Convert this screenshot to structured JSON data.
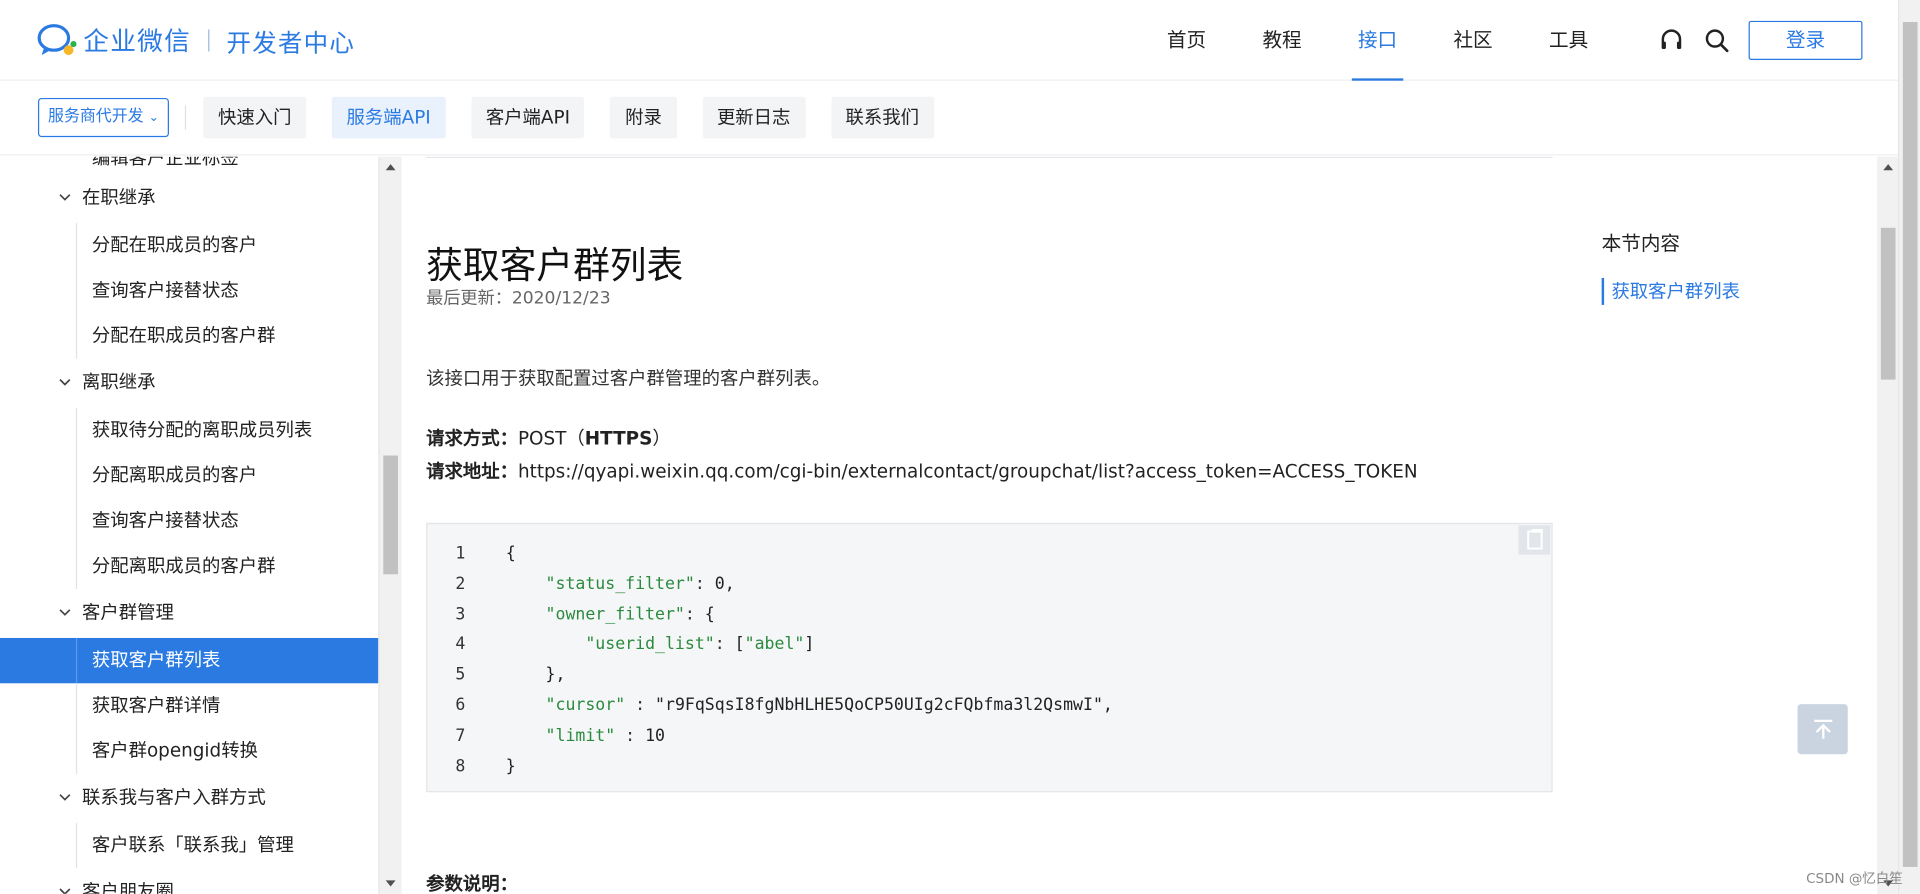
{
  "header": {
    "brand": "企业微信",
    "sub_brand": "开发者中心",
    "nav": [
      "首页",
      "教程",
      "接口",
      "社区",
      "工具"
    ],
    "nav_active": "接口",
    "login_label": "登录"
  },
  "subnav": {
    "mode_label": "服务商代开发",
    "tabs": [
      "快速入门",
      "服务端API",
      "客户端API",
      "附录",
      "更新日志",
      "联系我们"
    ],
    "active_tab": "服务端API"
  },
  "sidebar": {
    "cut_label": "编辑客户企业标签",
    "groups": [
      {
        "label": "在职继承",
        "items": [
          "分配在职成员的客户",
          "查询客户接替状态",
          "分配在职成员的客户群"
        ]
      },
      {
        "label": "离职继承",
        "items": [
          "获取待分配的离职成员列表",
          "分配离职成员的客户",
          "查询客户接替状态",
          "分配离职成员的客户群"
        ]
      },
      {
        "label": "客户群管理",
        "items": [
          "获取客户群列表",
          "获取客户群详情",
          "客户群opengid转换"
        ]
      },
      {
        "label": "联系我与客户入群方式",
        "items": [
          "客户联系「联系我」管理"
        ]
      },
      {
        "label": "客户朋友圈",
        "items": []
      }
    ],
    "active_item": "获取客户群列表"
  },
  "content": {
    "title": "获取客户群列表",
    "updated": "最后更新：2020/12/23",
    "description": "该接口用于获取配置过客户群管理的客户群列表。",
    "method_label": "请求方式：",
    "method_value": "POST（",
    "method_bold": "HTTPS",
    "method_end": "）",
    "url_label": "请求地址：",
    "url_value": "https://qyapi.weixin.qq.com/cgi-bin/externalcontact/groupchat/list?access_token=ACCESS_TOKEN",
    "code_lines": [
      "{",
      "    \"status_filter\": 0,",
      "    \"owner_filter\": {",
      "        \"userid_list\": [\"abel\"]",
      "    },",
      "    \"cursor\" : \"r9FqSqsI8fgNbHLHE5QoCP50UIg2cFQbfma3l2QsmwI\",",
      "    \"limit\" : 10",
      "}"
    ],
    "params_label": "参数说明："
  },
  "toc": {
    "title": "本节内容",
    "links": [
      "获取客户群列表"
    ]
  },
  "watermark": "CSDN @忆白笙",
  "colors": {
    "brand": "#2a7ae2",
    "code_key": "#2b8a3e",
    "code_num": "#d62c2c"
  }
}
